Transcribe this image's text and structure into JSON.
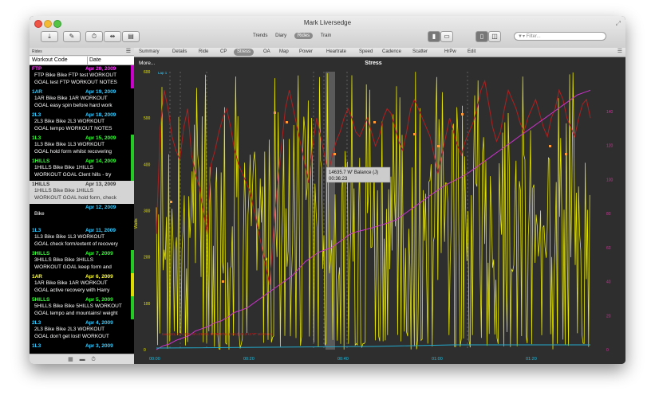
{
  "window": {
    "title": "Mark Liversedge"
  },
  "toolbar": {
    "buttons": [
      "download-icon",
      "edit-icon",
      "stopwatch-icon",
      "split-icon",
      "delete-icon"
    ],
    "views": [
      "Trends",
      "Diary",
      "Rides",
      "Train"
    ],
    "selected_view": "Rides",
    "filter_placeholder": "Filter..."
  },
  "sidebar": {
    "header": "Rides",
    "col_code": "Workout Code",
    "col_date": "Date",
    "items": [
      {
        "code": "FTP",
        "date": "Apr 20, 2009",
        "color": "#ff33ff",
        "bar": "#cc00cc",
        "l1": "FTP Bike Bike FTP test WORKOUT",
        "l2": "GOAL test FTP  WORKOUT NOTES"
      },
      {
        "code": "1AR",
        "date": "Apr 19, 2009",
        "color": "#33ccff",
        "bar": "",
        "l1": "1AR Bike Bike 1AR WORKOUT",
        "l2": "GOAL easy spin before hard work"
      },
      {
        "code": "2L3",
        "date": "Apr 18, 2009",
        "color": "#33ccff",
        "bar": "",
        "l1": "2L3 Bike Bike 2L3 WORKOUT",
        "l2": "GOAL tempo WORKOUT NOTES"
      },
      {
        "code": "1L3",
        "date": "Apr 15, 2009",
        "color": "#33ff33",
        "bar": "#22cc22",
        "l1": "1L3 Bike Bike 1L3 WORKOUT",
        "l2": "GOAL hold form whilst recovering"
      },
      {
        "code": "1HILLS",
        "date": "Apr 14, 2009",
        "color": "#33ff33",
        "bar": "#22cc22",
        "l1": "1HILLS Bike Bike 1HILLS",
        "l2": "WORKOUT GOAL Clent hills - try"
      },
      {
        "code": "1HILLS",
        "date": "Apr 13, 2009",
        "color": "#333333",
        "bar": "",
        "sel": true,
        "l1": "1HILLS Bike Bike 1HILLS",
        "l2": "WORKOUT GOAL hold form, check"
      },
      {
        "code": "",
        "date": "Apr 12, 2009",
        "color": "#33ccff",
        "bar": "",
        "l1": "Bike",
        "l2": ""
      },
      {
        "code": "1L3",
        "date": "Apr 11, 2009",
        "color": "#33ccff",
        "bar": "",
        "l1": "1L3 Bike Bike 1L3 WORKOUT",
        "l2": "GOAL check form/extent of recovery"
      },
      {
        "code": "3HILLS",
        "date": "Apr 7, 2009",
        "color": "#33ff33",
        "bar": "#22cc22",
        "l1": "3HILLS Bike Bike 3HILLS",
        "l2": "WORKOUT GOAL keep form and"
      },
      {
        "code": "1AR",
        "date": "Apr 6, 2009",
        "color": "#ffff33",
        "bar": "#dddd00",
        "l1": "1AR Bike Bike 1AR WORKOUT",
        "l2": "GOAL active recovery with Harry"
      },
      {
        "code": "5HILLS",
        "date": "Apr 5, 2009",
        "color": "#33ff33",
        "bar": "#22cc22",
        "l1": "5HILLS Bike Bike 5HILLS WORKOUT",
        "l2": "GOAL tempo and mountains! weight"
      },
      {
        "code": "2L3",
        "date": "Apr 4, 2009",
        "color": "#33ccff",
        "bar": "",
        "l1": "2L3 Bike Bike 2L3 WORKOUT",
        "l2": "GOAL don't get lost! WORKOUT"
      },
      {
        "code": "1L3",
        "date": "Apr 3, 2009",
        "color": "#33ccff",
        "bar": "",
        "l1": "",
        "l2": ""
      }
    ]
  },
  "tabs": [
    "Summary",
    "Details",
    "Ride",
    "CP",
    "Stress",
    "OA",
    "Map",
    "Power",
    "Heartrate",
    "Speed",
    "Cadence",
    "Scatter",
    "HrPw",
    "Edit"
  ],
  "selected_tab": "Stress",
  "chart_data": {
    "type": "line",
    "title": "Stress",
    "more_label": "More...",
    "lap_label": "Lap 1",
    "ylabel": "Watts",
    "yticks": [
      0,
      100,
      200,
      300,
      400,
      500,
      600
    ],
    "right_ticks": [
      0,
      20,
      40,
      60,
      80,
      100,
      120,
      140
    ],
    "xticks": [
      "00:00",
      "00:20",
      "00:40",
      "01:00",
      "01:20"
    ],
    "tooltip": [
      "14635.7 W' Balance (J)",
      "00:36:23"
    ],
    "annotation": "tau=261, CP=266, W'=21000, 10 Matches(>2kJ) 25.3 kJ W' Minimum",
    "colors": {
      "power": "#e6e600",
      "hr": "#b02020",
      "wbal": "#cc33cc",
      "zero": "#22aacc",
      "label": "#cc3399",
      "xtick": "#22bbdd"
    },
    "power_max": 600,
    "right_max": 140,
    "hr_series": [
      250,
      480,
      560,
      520,
      460,
      430,
      410,
      480,
      520,
      420,
      380,
      350,
      300,
      250,
      400,
      430,
      470,
      500,
      520,
      480,
      430,
      400,
      380,
      360,
      340,
      300,
      260,
      220,
      180,
      140,
      260,
      360,
      440,
      520,
      560,
      520,
      480,
      440,
      400,
      360,
      440,
      500,
      460,
      420,
      380,
      420,
      450,
      470,
      500,
      520,
      500,
      470,
      460,
      480,
      500,
      470,
      440,
      460,
      500,
      520,
      510,
      480,
      450,
      430,
      470,
      520,
      540,
      520,
      500,
      480,
      460,
      420,
      380,
      420,
      460,
      500,
      470,
      440,
      420,
      450,
      470,
      490,
      520,
      560,
      580,
      530,
      480,
      450,
      470,
      520,
      560,
      540,
      520,
      490,
      470,
      500,
      520,
      540,
      510,
      480,
      460,
      500,
      520,
      560,
      540,
      500,
      480,
      460,
      500,
      530,
      540,
      500
    ],
    "wbal_series": [
      0,
      8,
      12,
      20,
      25,
      30,
      40,
      45,
      50,
      58,
      62,
      70,
      80,
      85,
      90,
      100,
      110,
      120,
      130,
      140,
      150,
      160,
      175,
      190,
      200,
      210,
      215,
      220,
      230,
      240,
      250,
      255,
      258,
      262,
      266,
      270,
      275,
      280,
      290,
      300,
      310,
      320,
      330,
      340,
      350,
      358,
      365,
      372,
      380,
      390,
      400,
      410,
      420,
      430,
      440,
      450,
      460,
      470,
      480,
      490,
      500,
      510,
      520,
      530,
      540,
      550,
      555,
      560
    ]
  }
}
